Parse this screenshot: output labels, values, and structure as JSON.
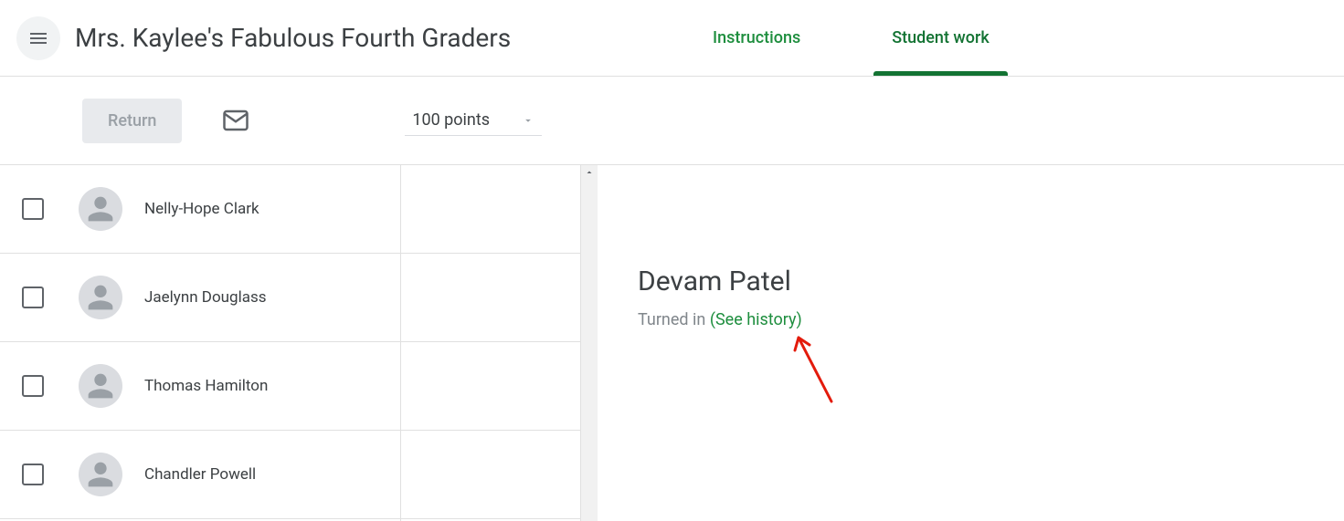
{
  "header": {
    "class_title": "Mrs. Kaylee's Fabulous Fourth Graders",
    "tabs": {
      "instructions": "Instructions",
      "student_work": "Student work"
    }
  },
  "toolbar": {
    "return_label": "Return",
    "points_label": "100 points"
  },
  "students": [
    {
      "name": "Nelly-Hope Clark"
    },
    {
      "name": "Jaelynn Douglass"
    },
    {
      "name": "Thomas Hamilton"
    },
    {
      "name": "Chandler Powell"
    }
  ],
  "detail": {
    "student_name": "Devam Patel",
    "status": "Turned in ",
    "history_link": "(See history)"
  }
}
